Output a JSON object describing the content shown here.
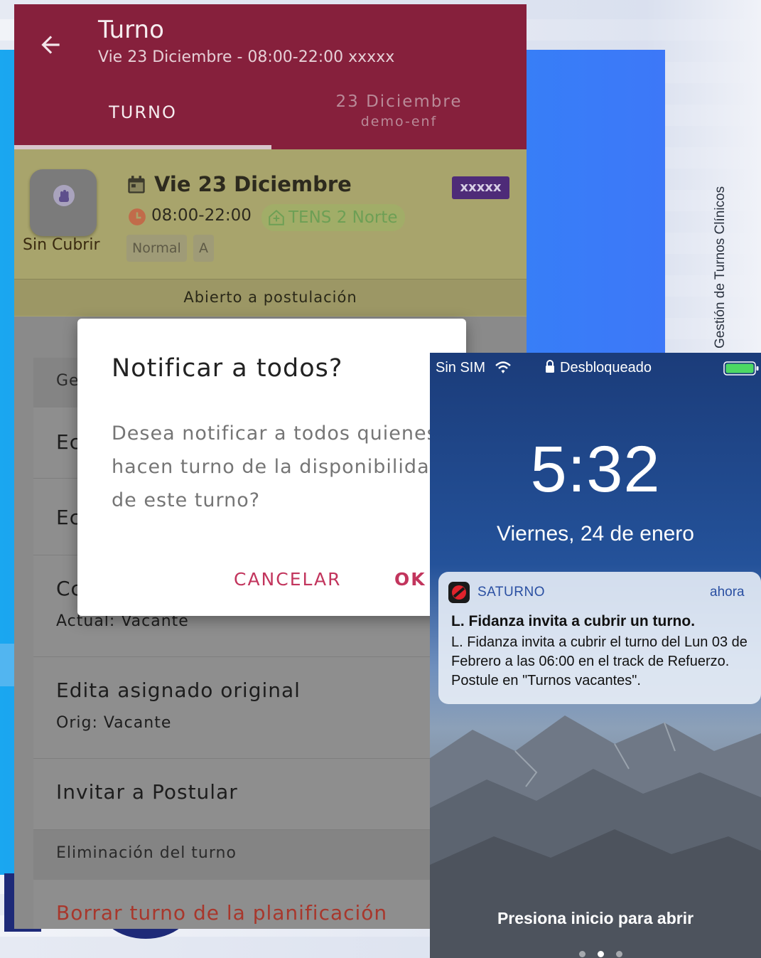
{
  "slide": {
    "side_title": "Gestión de Turnos Clínicos"
  },
  "app": {
    "header": {
      "title": "Turno",
      "subtitle": "Vie 23 Diciembre - 08:00-22:00 xxxxx",
      "back_icon": "arrow-left-icon",
      "color": "#86203c"
    },
    "tabs": [
      {
        "label": "TURNO",
        "selected": true
      },
      {
        "label_line1": "23 Diciembre",
        "label_line2": "demo-enf",
        "selected": false
      }
    ],
    "shift": {
      "status_label": "Sin Cubrir",
      "status_icon": "raised-hand-icon",
      "date": "Vie 23 Diciembre",
      "code_badge": "xxxxx",
      "time": "08:00-22:00",
      "place": "TENS 2 Norte",
      "tags": [
        "Normal",
        "A"
      ],
      "open_status": "Abierto a postulación"
    },
    "list": {
      "section1_header": "Ge",
      "rows": [
        {
          "title": "Ec"
        },
        {
          "title": "Ec"
        },
        {
          "title": "Cc",
          "sub": "Actual: Vacante"
        },
        {
          "title": "Edita asignado original",
          "sub": "Orig: Vacante"
        },
        {
          "title": "Invitar a Postular"
        }
      ],
      "section2_header": "Eliminación del turno",
      "danger_row": "Borrar turno de la planificación"
    },
    "dialog": {
      "title": "Notificar a todos?",
      "body": "Desea notificar a todos quienes hacen turno de la disponibilidad de este turno?",
      "cancel_label": "CANCELAR",
      "ok_label": "OK"
    }
  },
  "lockscreen": {
    "carrier": "Sin SIM",
    "lock_status": "Desbloqueado",
    "time": "5:32",
    "date": "Viernes, 24 de enero",
    "notification": {
      "app_name": "SATURNO",
      "when": "ahora",
      "title": "L. Fidanza invita a cubrir un turno.",
      "body": "L. Fidanza invita a cubrir el turno del Lun 03 de Febrero a las 06:00 en el track de Refuerzo. Postule en \"Turnos vacantes\"."
    },
    "hint": "Presiona inicio para abrir",
    "battery_color": "#4cd964"
  }
}
